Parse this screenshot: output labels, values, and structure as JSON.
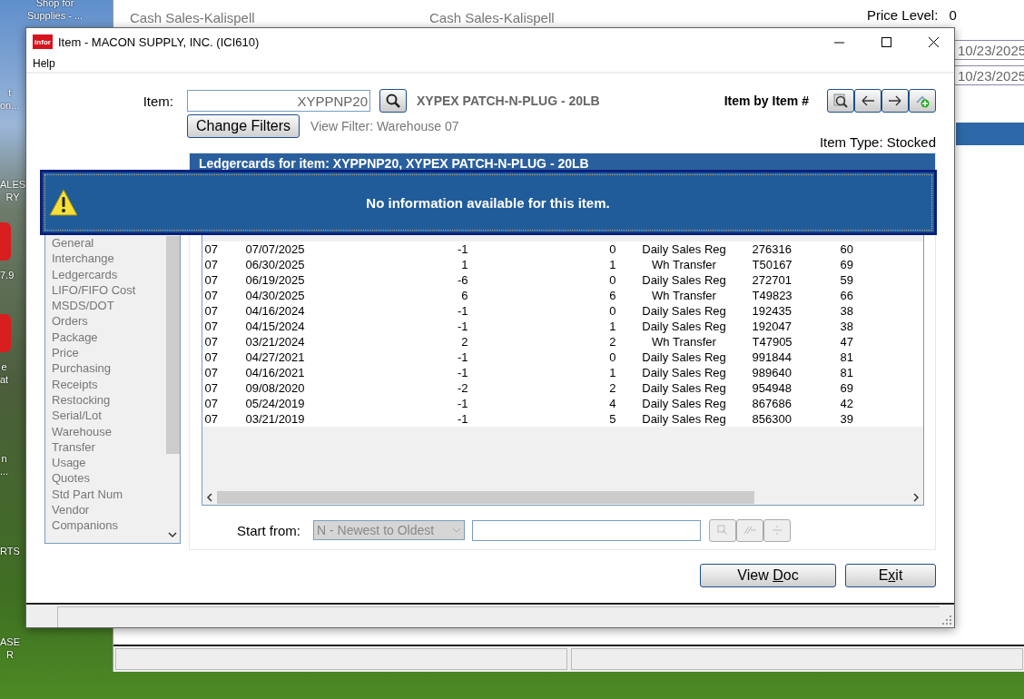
{
  "desktop": {
    "top_icon": {
      "lines": [
        "Shop for",
        "Supplies - ..."
      ]
    },
    "icons": [
      {
        "lines": [
          "t",
          "on..."
        ]
      },
      {
        "lines": [
          "ALES",
          "RY"
        ]
      },
      {
        "lines": [
          "7.9"
        ]
      },
      {
        "lines": [
          "e",
          "at"
        ]
      },
      {
        "lines": [
          "n",
          "..."
        ]
      },
      {
        "lines": [
          "RTS"
        ]
      },
      {
        "lines": [
          "ASE",
          "R"
        ]
      }
    ]
  },
  "background_window": {
    "location_labels": [
      "Cash Sales-Kalispell",
      "Cash Sales-Kalispell"
    ],
    "price_level": {
      "label": "Price Level:",
      "value": "0"
    },
    "date_fields": [
      "10/23/2025",
      "10/23/2025"
    ]
  },
  "dialog": {
    "title": "Item - MACON SUPPLY, INC. (ICI610)",
    "logo_text": "infor",
    "menu": [
      "Help"
    ],
    "item": {
      "label": "Item:",
      "value": "XYPPNP20",
      "description": "XYPEX PATCH-N-PLUG - 20LB"
    },
    "lookup_label": "Item by Item #",
    "change_filters": "Change Filters",
    "view_filter": "View Filter: Warehouse 07",
    "item_type": "Item Type: Stocked",
    "views": {
      "items": [
        "General",
        "Interchange",
        "Ledgercards",
        "LIFO/FIFO Cost",
        "MSDS/DOT",
        "Orders",
        "Package",
        "Price",
        "Purchasing",
        "Receipts",
        "Restocking",
        "Serial/Lot",
        "Warehouse",
        "Transfer",
        "Usage",
        "Quotes",
        "Std Part Num",
        "Vendor",
        "Companions"
      ]
    },
    "grid_title": "Ledgercards for item: XYPPNP20, XYPEX PATCH-N-PLUG - 20LB",
    "table": {
      "rows": [
        [
          "07",
          "07/07/2025",
          "-1",
          "0",
          "Daily Sales Reg",
          "276316",
          "60"
        ],
        [
          "07",
          "06/30/2025",
          "1",
          "1",
          "Wh Transfer",
          "T50167",
          "69"
        ],
        [
          "07",
          "06/19/2025",
          "-6",
          "0",
          "Daily Sales Reg",
          "272701",
          "59"
        ],
        [
          "07",
          "04/30/2025",
          "6",
          "6",
          "Wh Transfer",
          "T49823",
          "66"
        ],
        [
          "07",
          "04/16/2024",
          "-1",
          "0",
          "Daily Sales Reg",
          "192435",
          "38"
        ],
        [
          "07",
          "04/15/2024",
          "-1",
          "1",
          "Daily Sales Reg",
          "192047",
          "38"
        ],
        [
          "07",
          "03/21/2024",
          "2",
          "2",
          "Wh Transfer",
          "T47905",
          "47"
        ],
        [
          "07",
          "04/27/2021",
          "-1",
          "0",
          "Daily Sales Reg",
          "991844",
          "81"
        ],
        [
          "07",
          "04/16/2021",
          "-1",
          "1",
          "Daily Sales Reg",
          "989640",
          "81"
        ],
        [
          "07",
          "09/08/2020",
          "-2",
          "2",
          "Daily Sales Reg",
          "954948",
          "69"
        ],
        [
          "07",
          "05/24/2019",
          "-1",
          "4",
          "Daily Sales Reg",
          "867686",
          "42"
        ],
        [
          "07",
          "03/21/2019",
          "-1",
          "5",
          "Daily Sales Reg",
          "856300",
          "39"
        ]
      ]
    },
    "start_from": {
      "label": "Start from:",
      "value": "N - Newest to Oldest",
      "disabled": true
    },
    "search_tools": [
      {
        "disabled": true
      },
      {
        "disabled": true
      },
      {
        "disabled": true
      }
    ],
    "buttons": [
      {
        "before": "View ",
        "mnemonic": "D",
        "after": "oc"
      },
      {
        "before": "E",
        "mnemonic": "x",
        "after": "it"
      }
    ],
    "alert": {
      "kind": "warning",
      "message": "No information available for this item."
    }
  }
}
